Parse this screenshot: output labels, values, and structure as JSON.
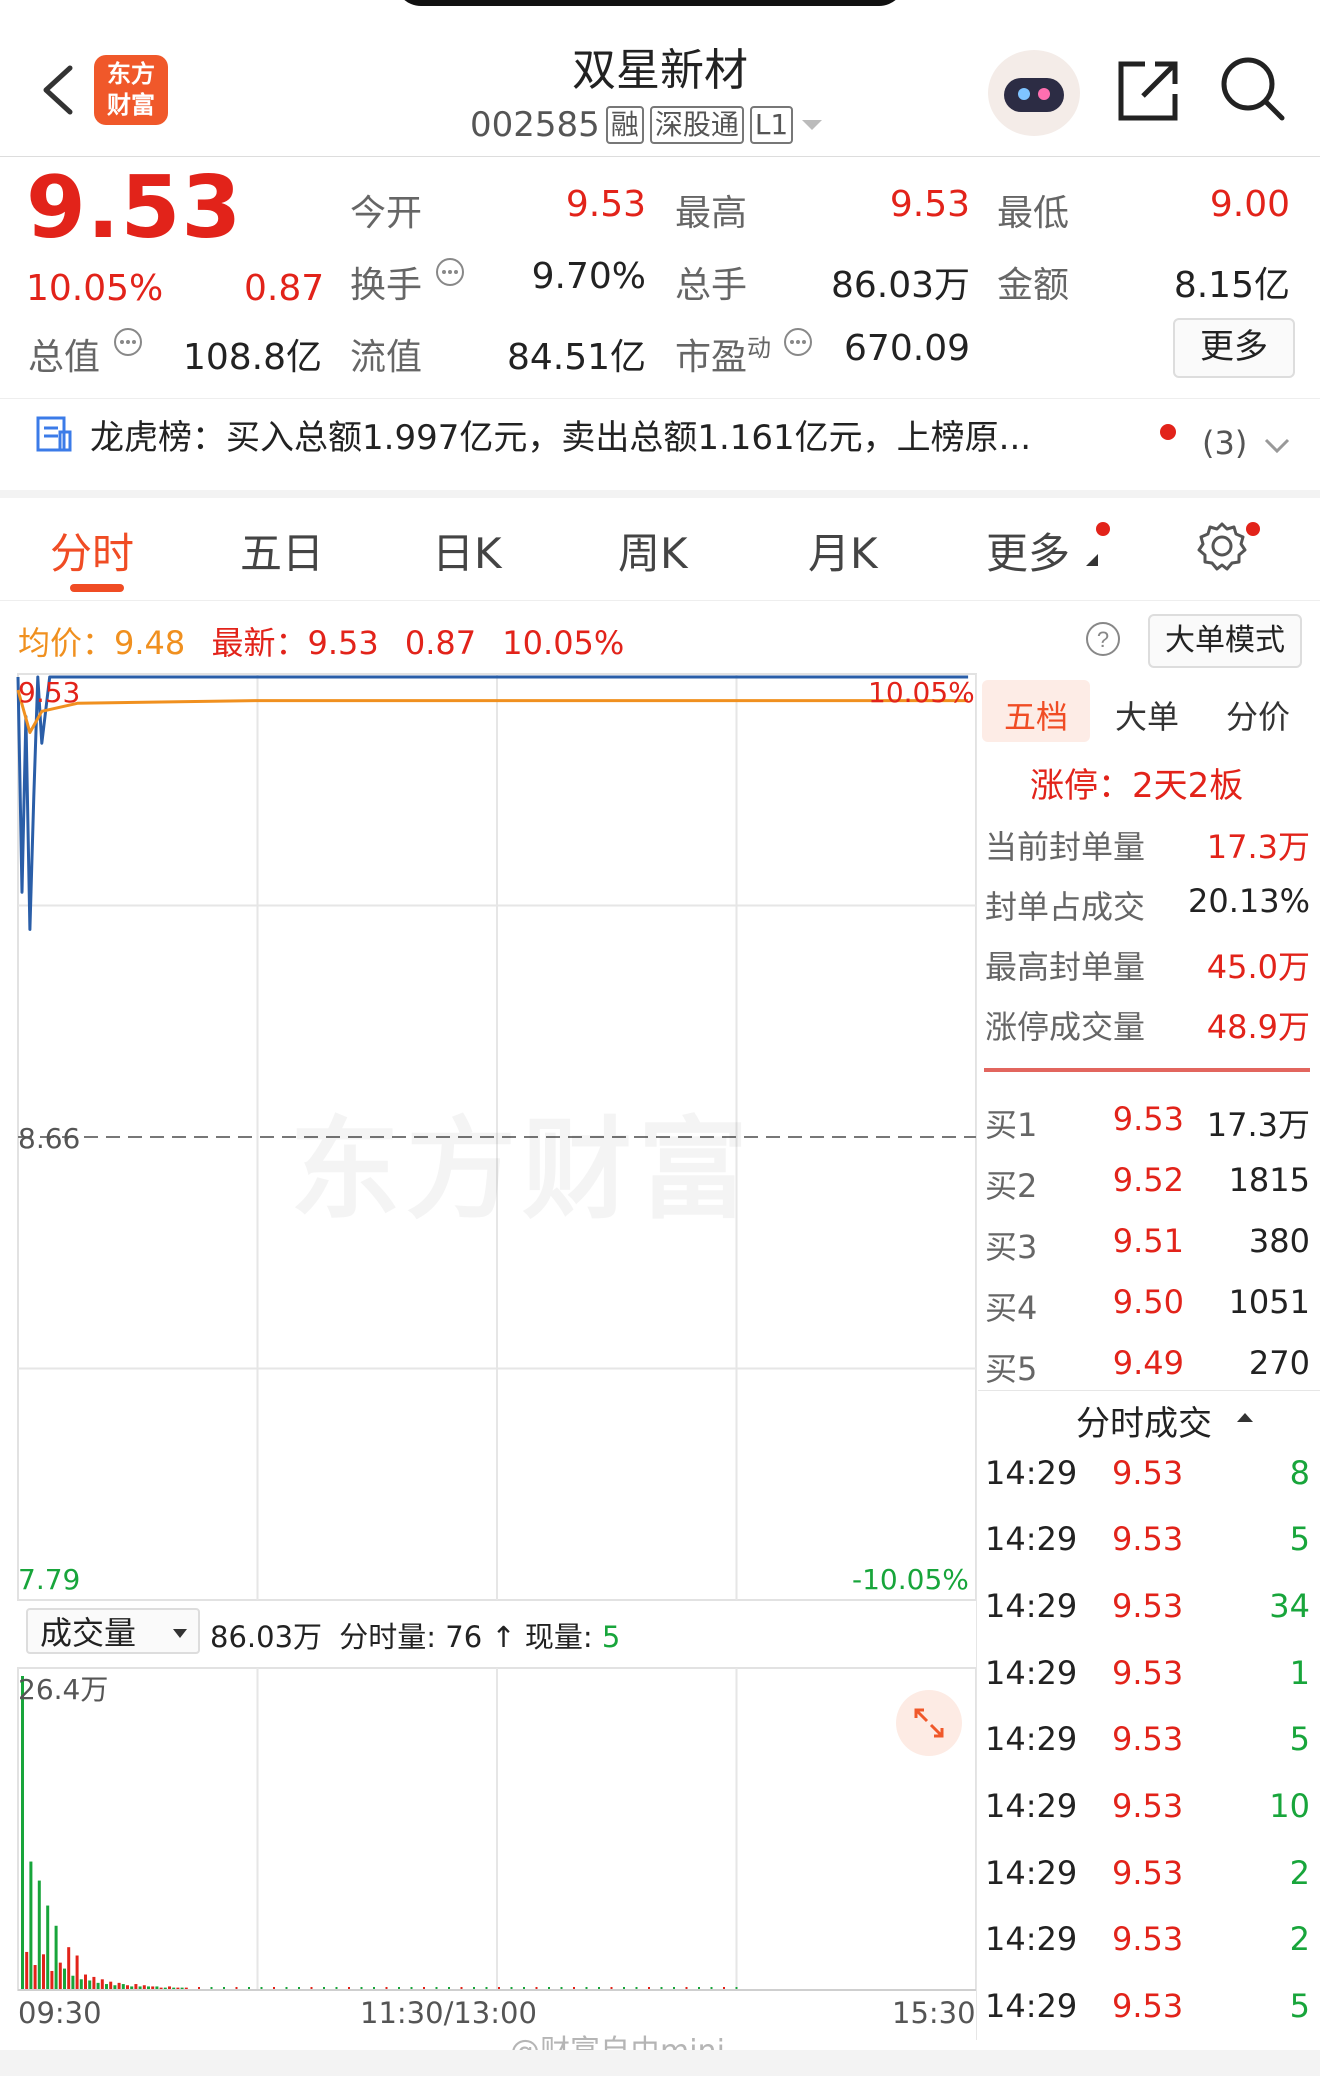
{
  "header": {
    "back_icon": "chevron-left-icon",
    "logo_line1": "东方",
    "logo_line2": "财富",
    "stock_name": "双星新材",
    "stock_code": "002585",
    "tags": [
      "融",
      "深股通",
      "L1"
    ],
    "robot_icon": "robot-avatar-icon",
    "share_icon": "share-icon",
    "search_icon": "search-icon"
  },
  "quote": {
    "price": "9.53",
    "change_pct": "10.05%",
    "change": "0.87",
    "open_label": "今开",
    "open": "9.53",
    "high_label": "最高",
    "high": "9.53",
    "low_label": "最低",
    "low": "9.00",
    "turnover_label": "换手",
    "turnover": "9.70%",
    "volume_label": "总手",
    "volume": "86.03万",
    "amount_label": "金额",
    "amount": "8.15亿",
    "mktcap_label": "总值",
    "mktcap": "108.8亿",
    "float_label": "流值",
    "float": "84.51亿",
    "pe_label": "市盈",
    "pe_sup": "动",
    "pe": "670.09",
    "more_button": "更多"
  },
  "news": {
    "text": "龙虎榜：买入总额1.997亿元，卖出总额1.161亿元，上榜原...",
    "count": "(3)"
  },
  "tabs": [
    "分时",
    "五日",
    "日K",
    "周K",
    "月K",
    "更多"
  ],
  "info_row": {
    "avg_label": "均价：",
    "avg": "9.48",
    "latest_label": "最新：",
    "latest": "9.53",
    "chg": "0.87",
    "chg_pct": "10.05%",
    "help_icon": "question-icon",
    "big_order_mode": "大单模式"
  },
  "chart_data": {
    "type": "line",
    "y_top_label": "9.53",
    "y_mid_label": "8.66",
    "y_bottom_label": "7.79",
    "right_top_label": "10.05%",
    "right_bottom_label": "-10.05%",
    "ylim": [
      7.79,
      9.53
    ],
    "series": [
      {
        "points": [
          [
            0,
            9.53
          ],
          [
            1,
            9.12
          ],
          [
            2,
            9.45
          ],
          [
            3,
            9.05
          ],
          [
            4,
            9.3
          ],
          [
            5,
            9.53
          ],
          [
            6,
            9.4
          ],
          [
            8,
            9.53
          ],
          [
            240,
            9.53
          ]
        ]
      },
      {
        "points": [
          [
            0,
            9.5
          ],
          [
            3,
            9.42
          ],
          [
            6,
            9.46
          ],
          [
            15,
            9.475
          ],
          [
            60,
            9.48
          ],
          [
            240,
            9.48
          ]
        ]
      }
    ],
    "volume": {
      "selector": "成交量",
      "total": "86.03万",
      "minute_label": "分时量:",
      "minute": "76",
      "now_label": "现量:",
      "now": "5",
      "max_label": "26.4万",
      "bars_wan": [
        26.4,
        3.2,
        10.8,
        2.1,
        9.2,
        3.0,
        7.1,
        1.6,
        5.4,
        2.3,
        1.8,
        3.6,
        1.2,
        2.9,
        0.9,
        1.3,
        0.8,
        1.1,
        0.6,
        0.9,
        0.5,
        0.7,
        0.4,
        0.6,
        0.5,
        0.4,
        0.3,
        0.5,
        0.3,
        0.4,
        0.3,
        0.3,
        0.3,
        0.2,
        0.2,
        0.3,
        0.2,
        0.2,
        0.2,
        0.2
      ]
    },
    "x_labels": [
      "09:30",
      "11:30/13:00",
      "15:30"
    ]
  },
  "side_panel": {
    "tabs": [
      "五档",
      "大单",
      "分价"
    ],
    "limit_title": "涨停：2天2板",
    "stats": [
      {
        "label": "当前封单量",
        "value": "17.3万"
      },
      {
        "label": "封单占成交",
        "value": "20.13%"
      },
      {
        "label": "最高封单量",
        "value": "45.0万"
      },
      {
        "label": "涨停成交量",
        "value": "48.9万"
      }
    ],
    "bids": [
      {
        "label": "买1",
        "price": "9.53",
        "vol": "17.3万"
      },
      {
        "label": "买2",
        "price": "9.52",
        "vol": "1815"
      },
      {
        "label": "买3",
        "price": "9.51",
        "vol": "380"
      },
      {
        "label": "买4",
        "price": "9.50",
        "vol": "1051"
      },
      {
        "label": "买5",
        "price": "9.49",
        "vol": "270"
      }
    ],
    "ticks_title": "分时成交",
    "ticks": [
      {
        "time": "14:29",
        "price": "9.53",
        "vol": "8"
      },
      {
        "time": "14:29",
        "price": "9.53",
        "vol": "5"
      },
      {
        "time": "14:29",
        "price": "9.53",
        "vol": "34"
      },
      {
        "time": "14:29",
        "price": "9.53",
        "vol": "1"
      },
      {
        "time": "14:29",
        "price": "9.53",
        "vol": "5"
      },
      {
        "time": "14:29",
        "price": "9.53",
        "vol": "10"
      },
      {
        "time": "14:29",
        "price": "9.53",
        "vol": "2"
      },
      {
        "time": "14:29",
        "price": "9.53",
        "vol": "2"
      },
      {
        "time": "14:29",
        "price": "9.53",
        "vol": "5"
      }
    ]
  },
  "watermark": "东方财富",
  "footer_watermark": "@财富自由mini",
  "colors": {
    "up": "#e2231a",
    "down": "#18a53b",
    "avg": "#f0901f",
    "price_line": "#2a5ea8"
  }
}
